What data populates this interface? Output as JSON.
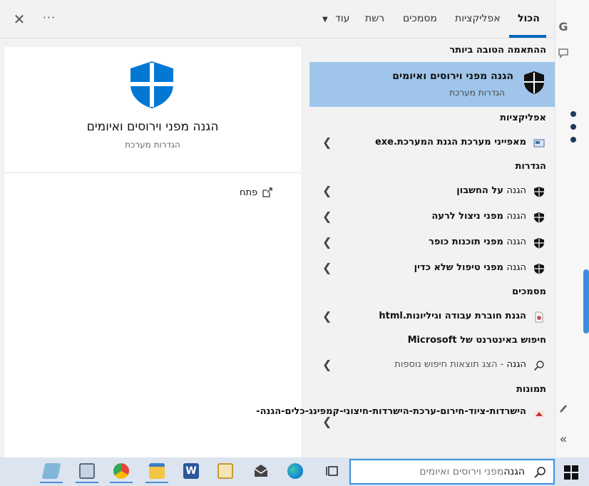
{
  "tabs": {
    "all": "הכול",
    "apps": "אפליקציות",
    "documents": "מסמכים",
    "web": "רשת",
    "more": "עוד"
  },
  "preview": {
    "title": "הגנה מפני וירוסים ואיומים",
    "subtitle": "הגדרות מערכת",
    "open_label": "פתח"
  },
  "results": {
    "best_match_title": "ההתאמה הטובה ביותר",
    "best_match": {
      "name": "הגנה מפני וירוסים ואיומים",
      "type": "הגדרות מערכת"
    },
    "apps_title": "אפליקציות",
    "apps": [
      {
        "label": "מאפייני מערכת הגנת המערכת.exe"
      }
    ],
    "settings_title": "הגדרות",
    "settings": [
      {
        "pre": "הגנה",
        "bold": " על החשבון"
      },
      {
        "pre": "הגנה",
        "bold": " מפני ניצול לרעה"
      },
      {
        "pre": "הגנה",
        "bold": " מפני תוכנות כופר"
      },
      {
        "pre": "הגנה",
        "bold": " מפני טיפול שלא כדין"
      }
    ],
    "docs_title": "מסמכים",
    "docs": [
      {
        "label": "הגנת חוברת עבודה וגיליונות.html"
      }
    ],
    "web_title": "חיפוש באינטרנט של Microsoft",
    "web": {
      "pre": "הגנה",
      "sub": " - הצג תוצאות חיפוש נוספות"
    },
    "photos_title": "תמונות",
    "photos": [
      {
        "label": "הישרדות-ציוד-חירום-ערכת-הישרדות-חיצוני-קמפינג-כלים-הגנה-"
      }
    ]
  },
  "taskbar": {
    "search_typed": "הגנה",
    "search_ghost": "מפני וירוסים ואיומים"
  },
  "colors": {
    "accent": "#0067c0",
    "selected_bg": "#9fc6ea",
    "shield_blue": "#0078d4"
  }
}
